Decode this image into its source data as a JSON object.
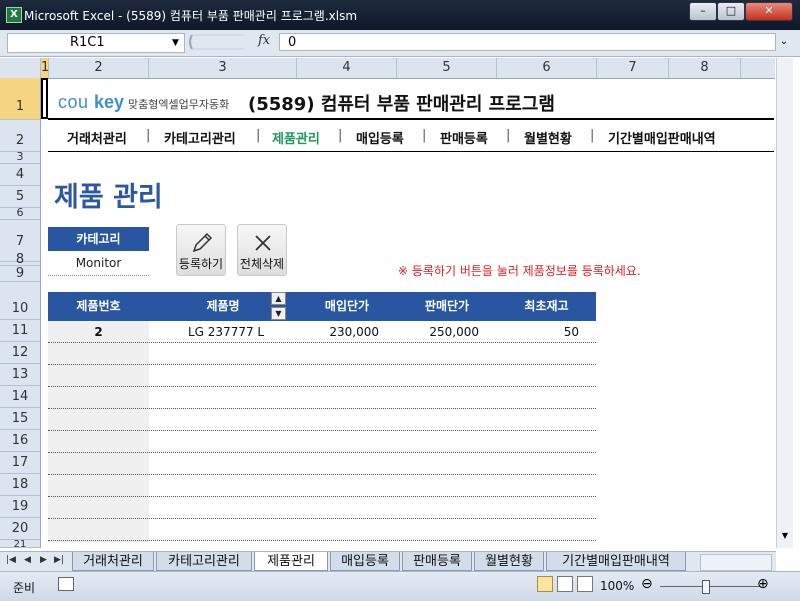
{
  "window": {
    "title": "Microsoft Excel - (5589) 컴퓨터 부품 판매관리 프로그램.xlsm",
    "app_icon": "X",
    "min": "–",
    "restore": "□",
    "close": "✕"
  },
  "formula_bar": {
    "name_box": "R1C1",
    "fx": "fx",
    "value": "0"
  },
  "columns": [
    "1",
    "2",
    "3",
    "4",
    "5",
    "6",
    "7",
    "8"
  ],
  "rows": [
    "1",
    "2",
    "3",
    "4",
    "5",
    "6",
    "7",
    "8",
    "9",
    "10",
    "11",
    "12",
    "13",
    "14",
    "15",
    "16",
    "17",
    "18",
    "19",
    "20",
    "21"
  ],
  "logo": {
    "part1": "cou",
    "part2": "key",
    "tagline": "맞춤형엑셀업무자동화"
  },
  "program_title": "(5589) 컴퓨터 부품 판매관리 프로그램",
  "nav": [
    "거래처관리",
    "카테고리관리",
    "제품관리",
    "매입등록",
    "판매등록",
    "월별현황",
    "기간별매입판매내역"
  ],
  "nav_active": "제품관리",
  "page_title": "제품 관리",
  "category": {
    "label": "카테고리",
    "value": "Monitor"
  },
  "buttons": {
    "register": "등록하기",
    "delete_all": "전체삭제"
  },
  "notice": "※ 등록하기 버튼을 눌러 제품정보를 등록하세요.",
  "table": {
    "headers": [
      "제품번호",
      "제품명",
      "매입단가",
      "판매단가",
      "최초재고"
    ],
    "rows": [
      [
        "2",
        "LG 237777 L",
        "230,000",
        "250,000",
        "50"
      ]
    ]
  },
  "sheet_tabs": [
    "거래처관리",
    "카테고리관리",
    "제품관리",
    "매입등록",
    "판매등록",
    "월별현황",
    "기간별매입판매내역"
  ],
  "active_tab": "제품관리",
  "status": {
    "ready": "준비",
    "zoom": "100%"
  },
  "colors": {
    "accent": "#2856a0",
    "nav_active": "#1e9a5a",
    "notice": "#d81e1e"
  }
}
